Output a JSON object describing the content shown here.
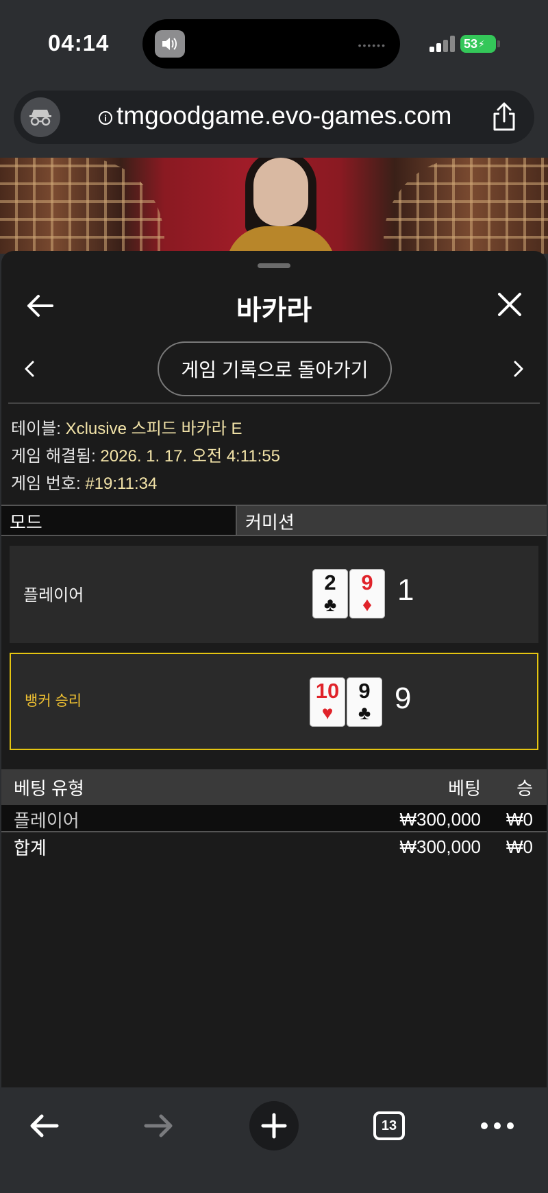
{
  "status": {
    "time": "04:14",
    "battery": "53"
  },
  "browser": {
    "url": "tmgoodgame.evo-games.com"
  },
  "panel": {
    "title": "바카라",
    "history_button": "게임 기록으로 돌아가기",
    "meta": {
      "table_label": "테이블:",
      "table_value": "Xclusive 스피드 바카라 E",
      "resolved_label": "게임 해결됨:",
      "resolved_value": "2026. 1. 17. 오전 4:11:55",
      "game_no_label": "게임 번호:",
      "game_no_value": "#19:11:34"
    },
    "mode_label": "모드",
    "mode_value": "커미션",
    "hands": [
      {
        "label": "플레이어",
        "score": "1",
        "cards": [
          {
            "rank": "2",
            "suit": "♣",
            "color": "black"
          },
          {
            "rank": "9",
            "suit": "♦",
            "color": "red"
          }
        ]
      },
      {
        "label": "뱅커 승리",
        "score": "9",
        "cards": [
          {
            "rank": "10",
            "suit": "♥",
            "color": "red"
          },
          {
            "rank": "9",
            "suit": "♣",
            "color": "black"
          }
        ]
      }
    ],
    "bets": {
      "headers": [
        "베팅 유형",
        "베팅",
        "승"
      ],
      "rows": [
        {
          "type": "플레이어",
          "bet": "₩300,000",
          "win": "₩0"
        }
      ],
      "total": {
        "label": "합계",
        "bet": "₩300,000",
        "win": "₩0"
      }
    }
  },
  "toolbar": {
    "tab_count": "13"
  },
  "colors": {
    "accent_yellow": "#e5c511",
    "meta_value": "#f2e3a8",
    "battery_green": "#34c759",
    "card_red": "#e0232a"
  }
}
